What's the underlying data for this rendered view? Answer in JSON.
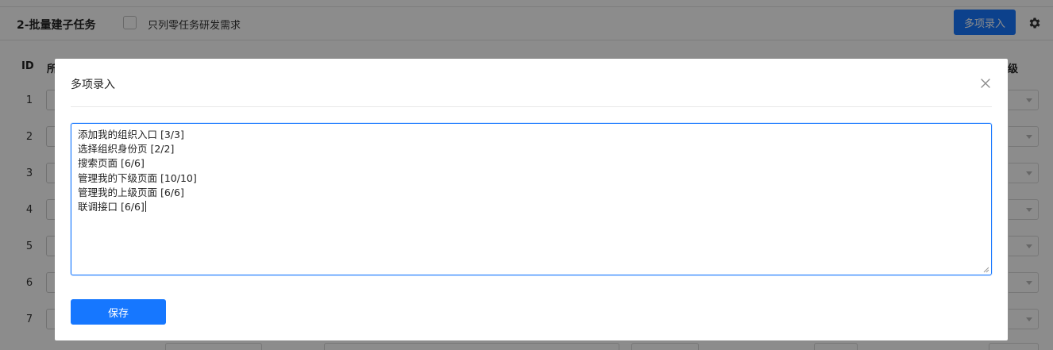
{
  "header": {
    "title": "2-批量建子任务",
    "checkbox_label": "只列零任务研发需求",
    "multi_entry_button": "多项录入"
  },
  "table": {
    "col_id": "ID",
    "col_belong": "所",
    "col_priority": "级",
    "row_ids": [
      "1",
      "2",
      "3",
      "4",
      "5",
      "6",
      "7"
    ]
  },
  "modal": {
    "title": "多项录入",
    "lines": [
      "添加我的组织入口 [3/3]",
      "选择组织身份页 [2/2]",
      "搜索页面 [6/6]",
      "管理我的下级页面 [10/10]",
      "管理我的上级页面 [6/6]",
      "联调接口 [6/6]"
    ],
    "save_button": "保存"
  }
}
